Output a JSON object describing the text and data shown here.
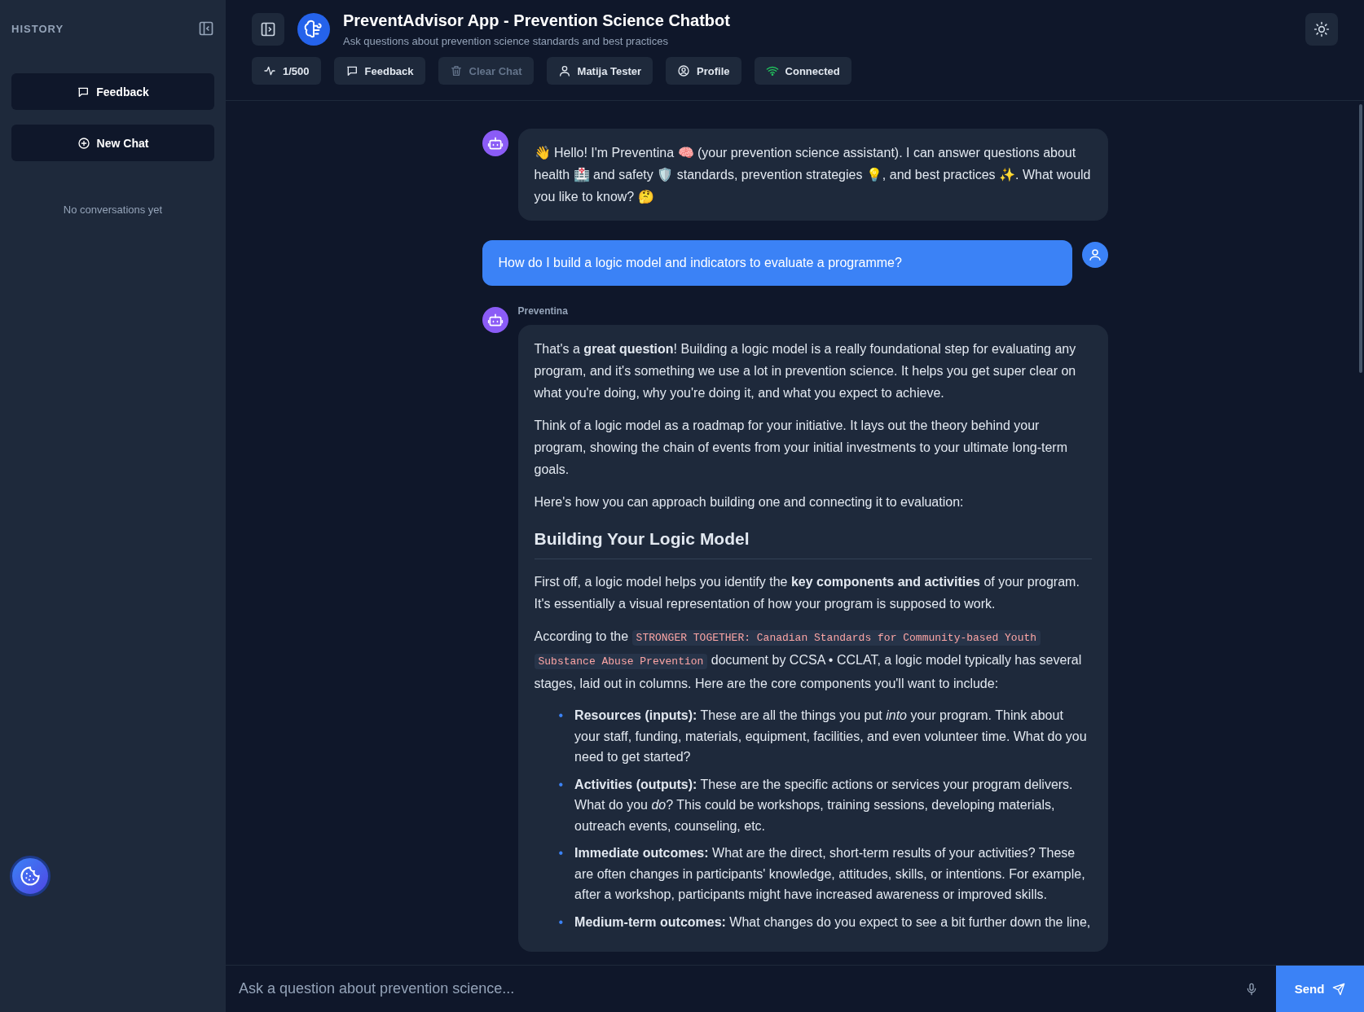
{
  "sidebar": {
    "title": "HISTORY",
    "buttons": [
      {
        "label": "Feedback"
      },
      {
        "label": "New Chat"
      }
    ],
    "empty_text": "No conversations yet"
  },
  "header": {
    "title": "PreventAdvisor App - Prevention Science Chatbot",
    "subtitle": "Ask questions about prevention science standards and best practices",
    "chips": [
      {
        "label": "1/500",
        "disabled": false
      },
      {
        "label": "Feedback",
        "disabled": false
      },
      {
        "label": "Clear Chat",
        "disabled": true
      },
      {
        "label": "Matija Tester",
        "disabled": false
      },
      {
        "label": "Profile",
        "disabled": false
      },
      {
        "label": "Connected",
        "disabled": false
      }
    ]
  },
  "messages": [
    {
      "kind": "assistant",
      "text": "👋 Hello! I'm Preventina 🧠 (your prevention science assistant). I can answer questions about health 🏥 and safety 🛡️ standards, prevention strategies 💡, and best practices ✨. What would you like to know? 🤔"
    },
    {
      "kind": "user",
      "text": "How do I build a logic model and indicators to evaluate a programme?"
    },
    {
      "kind": "assistant",
      "author": "Preventina",
      "blocks": [
        {
          "kind": "paragraph",
          "text": "That's a **great question**! Building a logic model is a really foundational step for evaluating any program, and it's something we use a lot in prevention science. It helps you get super clear on what you're doing, why you're doing it, and what you expect to achieve."
        },
        {
          "kind": "paragraph",
          "text": "Think of a logic model as a roadmap for your initiative. It lays out the theory behind your program, showing the chain of events from your initial investments to your ultimate long-term goals."
        },
        {
          "kind": "paragraph",
          "text": "Here's how you can approach building one and connecting it to evaluation:"
        },
        {
          "kind": "heading",
          "text": "Building Your Logic Model"
        },
        {
          "kind": "paragraph",
          "text": "First off, a logic model helps you identify the **key components and activities** of your program. It's essentially a visual representation of how your program is supposed to work."
        },
        {
          "kind": "code_paragraph",
          "before": "According to the",
          "code_lines": [
            "STRONGER TOGETHER: Canadian Standards for Community-based Youth",
            "Substance Abuse Prevention"
          ],
          "after": "document by CCSA • CCLAT, a logic model typically has several stages, laid out in columns. Here are the core components you'll want to include:"
        },
        {
          "kind": "list",
          "marker": "•",
          "items": [
            "**Resources (inputs):** These are all the things you put *into* your program. Think about your staff, funding, materials, equipment, facilities, and even volunteer time. What do you need to get started?",
            "**Activities (outputs):** These are the specific actions or services your program delivers. What do you *do*? This could be workshops, training sessions, developing materials, outreach events, counseling, etc.",
            "**Immediate outcomes:** What are the direct, short-term results of your activities? These are often changes in participants' knowledge, attitudes, skills, or intentions. For example, after a workshop, participants might have increased awareness or improved skills.",
            "**Medium-term outcomes:** What changes do you expect to see a bit further down the line,"
          ]
        }
      ]
    }
  ],
  "input": {
    "placeholder": "Ask a question about prevention science...",
    "send_label": "Send"
  }
}
